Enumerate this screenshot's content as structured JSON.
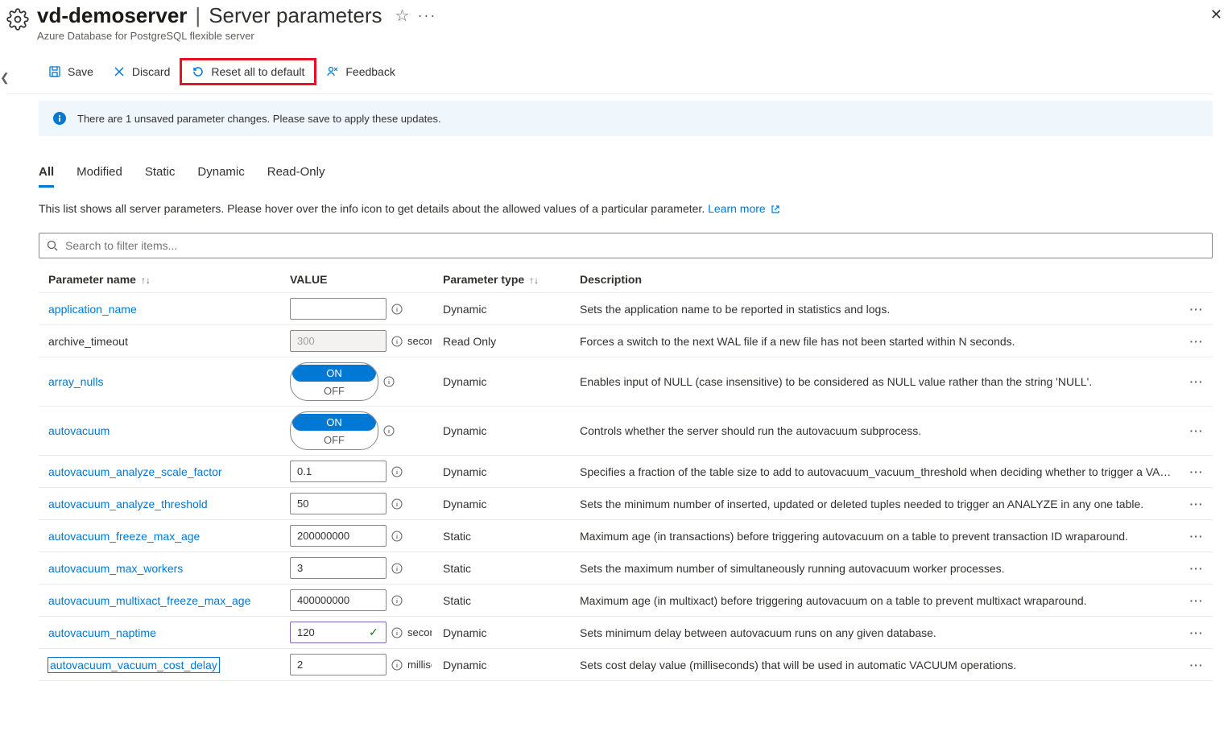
{
  "header": {
    "server_name": "vd-demoserver",
    "page_label": "Server parameters",
    "subtitle": "Azure Database for PostgreSQL flexible server"
  },
  "toolbar": {
    "save": "Save",
    "discard": "Discard",
    "reset": "Reset all to default",
    "feedback": "Feedback"
  },
  "notice": "There are 1 unsaved parameter changes.  Please save to apply these updates.",
  "tabs": [
    "All",
    "Modified",
    "Static",
    "Dynamic",
    "Read-Only"
  ],
  "helper": {
    "text": "This list shows all server parameters. Please hover over the info icon to get details about the allowed values of a particular parameter. ",
    "link_text": "Learn more"
  },
  "search_placeholder": "Search to filter items...",
  "columns": {
    "name": "Parameter name",
    "value": "VALUE",
    "type": "Parameter type",
    "desc": "Description"
  },
  "rows": [
    {
      "name": "application_name",
      "input_kind": "text",
      "value": "",
      "unit": "",
      "type": "Dynamic",
      "desc": "Sets the application name to be reported in statistics and logs.",
      "link": true
    },
    {
      "name": "archive_timeout",
      "input_kind": "text",
      "value": "300",
      "disabled": true,
      "unit": "seconds",
      "type": "Read Only",
      "desc": "Forces a switch to the next WAL file if a new file has not been started within N seconds.",
      "link": false
    },
    {
      "name": "array_nulls",
      "input_kind": "toggle",
      "value": "ON",
      "type": "Dynamic",
      "desc": "Enables input of NULL (case insensitive) to be considered as NULL value rather than the string 'NULL'.",
      "link": true
    },
    {
      "name": "autovacuum",
      "input_kind": "toggle",
      "value": "ON",
      "type": "Dynamic",
      "desc": "Controls whether the server should run the autovacuum subprocess.",
      "link": true
    },
    {
      "name": "autovacuum_analyze_scale_factor",
      "input_kind": "text",
      "value": "0.1",
      "unit": "",
      "type": "Dynamic",
      "desc": "Specifies a fraction of the table size to add to autovacuum_vacuum_threshold when deciding whether to trigger a VACUUM.",
      "link": true
    },
    {
      "name": "autovacuum_analyze_threshold",
      "input_kind": "text",
      "value": "50",
      "unit": "",
      "type": "Dynamic",
      "desc": "Sets the minimum number of inserted, updated or deleted tuples needed to trigger an ANALYZE in any one table.",
      "link": true
    },
    {
      "name": "autovacuum_freeze_max_age",
      "input_kind": "text",
      "value": "200000000",
      "unit": "",
      "type": "Static",
      "desc": "Maximum age (in transactions) before triggering autovacuum on a table to prevent transaction ID wraparound.",
      "link": true
    },
    {
      "name": "autovacuum_max_workers",
      "input_kind": "text",
      "value": "3",
      "unit": "",
      "type": "Static",
      "desc": "Sets the maximum number of simultaneously running autovacuum worker processes.",
      "link": true
    },
    {
      "name": "autovacuum_multixact_freeze_max_age",
      "input_kind": "text",
      "value": "400000000",
      "unit": "",
      "type": "Static",
      "desc": "Maximum age (in multixact) before triggering autovacuum on a table to prevent multixact wraparound.",
      "link": true
    },
    {
      "name": "autovacuum_naptime",
      "input_kind": "text",
      "value": "120",
      "modified": true,
      "unit": "seconds",
      "type": "Dynamic",
      "desc": "Sets minimum delay between autovacuum runs on any given database.",
      "link": true
    },
    {
      "name": "autovacuum_vacuum_cost_delay",
      "input_kind": "text",
      "value": "2",
      "unit": "milliseconds",
      "type": "Dynamic",
      "desc": "Sets cost delay value (milliseconds) that will be used in automatic VACUUM operations.",
      "link": true,
      "focused": true
    }
  ]
}
